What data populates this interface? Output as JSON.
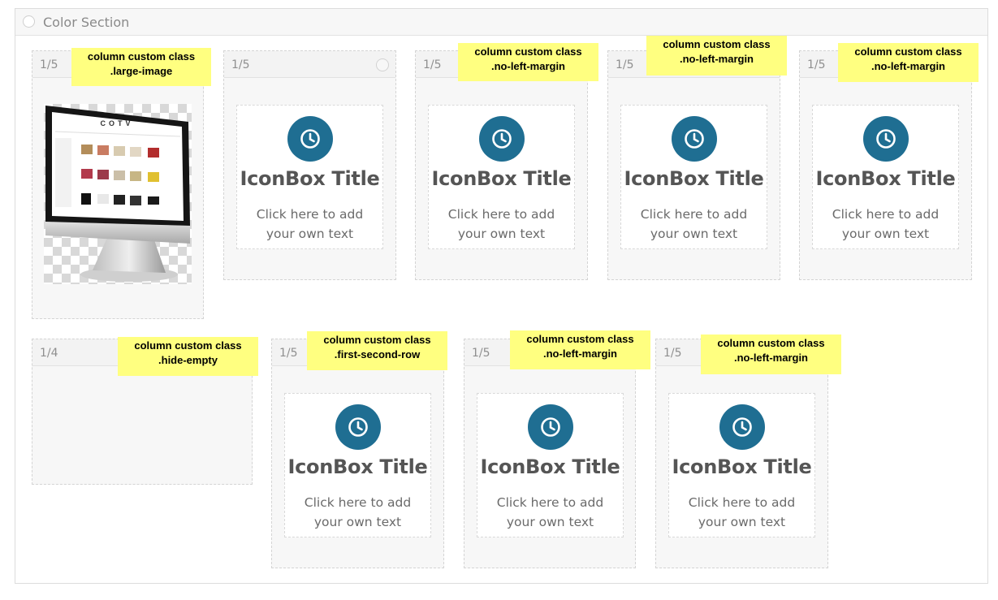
{
  "section": {
    "title": "Color Section"
  },
  "monitor": {
    "brand": "COTV"
  },
  "columns": [
    {
      "size": "1/5"
    },
    {
      "size": "1/5"
    },
    {
      "size": "1/5"
    },
    {
      "size": "1/5"
    },
    {
      "size": "1/5"
    },
    {
      "size": "1/4"
    },
    {
      "size": "1/5"
    },
    {
      "size": "1/5"
    },
    {
      "size": "1/5"
    }
  ],
  "iconbox": {
    "title": "IconBox Title",
    "text_line1": "Click here to add",
    "text_line2": "your own text",
    "icon": "clock-icon",
    "color": "#1f6e92"
  },
  "notes": [
    {
      "line1": "column custom class",
      "line2": ".large-image"
    },
    {
      "line1": "column custom class",
      "line2": ".no-left-margin"
    },
    {
      "line1": "column custom class",
      "line2": ".no-left-margin"
    },
    {
      "line1": "column custom class",
      "line2": ".no-left-margin"
    },
    {
      "line1": "column custom class",
      "line2": ".hide-empty"
    },
    {
      "line1": "column custom class",
      "line2": ".first-second-row"
    },
    {
      "line1": "column custom class",
      "line2": ".no-left-margin"
    },
    {
      "line1": "column custom class",
      "line2": ".no-left-margin"
    }
  ],
  "colors": {
    "note_bg": "#ffff80",
    "accent": "#1f6e92"
  }
}
